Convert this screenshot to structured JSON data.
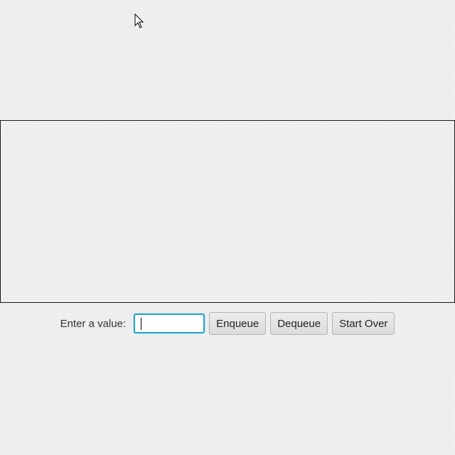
{
  "controls": {
    "value_label": "Enter a value:",
    "value_input": "",
    "enqueue_label": "Enqueue",
    "dequeue_label": "Dequeue",
    "start_over_label": "Start Over"
  },
  "icons": {
    "cursor": "mouse-pointer-icon"
  },
  "colors": {
    "input_focus_border": "#29a3c9",
    "pane_border": "#1a1a1a"
  }
}
